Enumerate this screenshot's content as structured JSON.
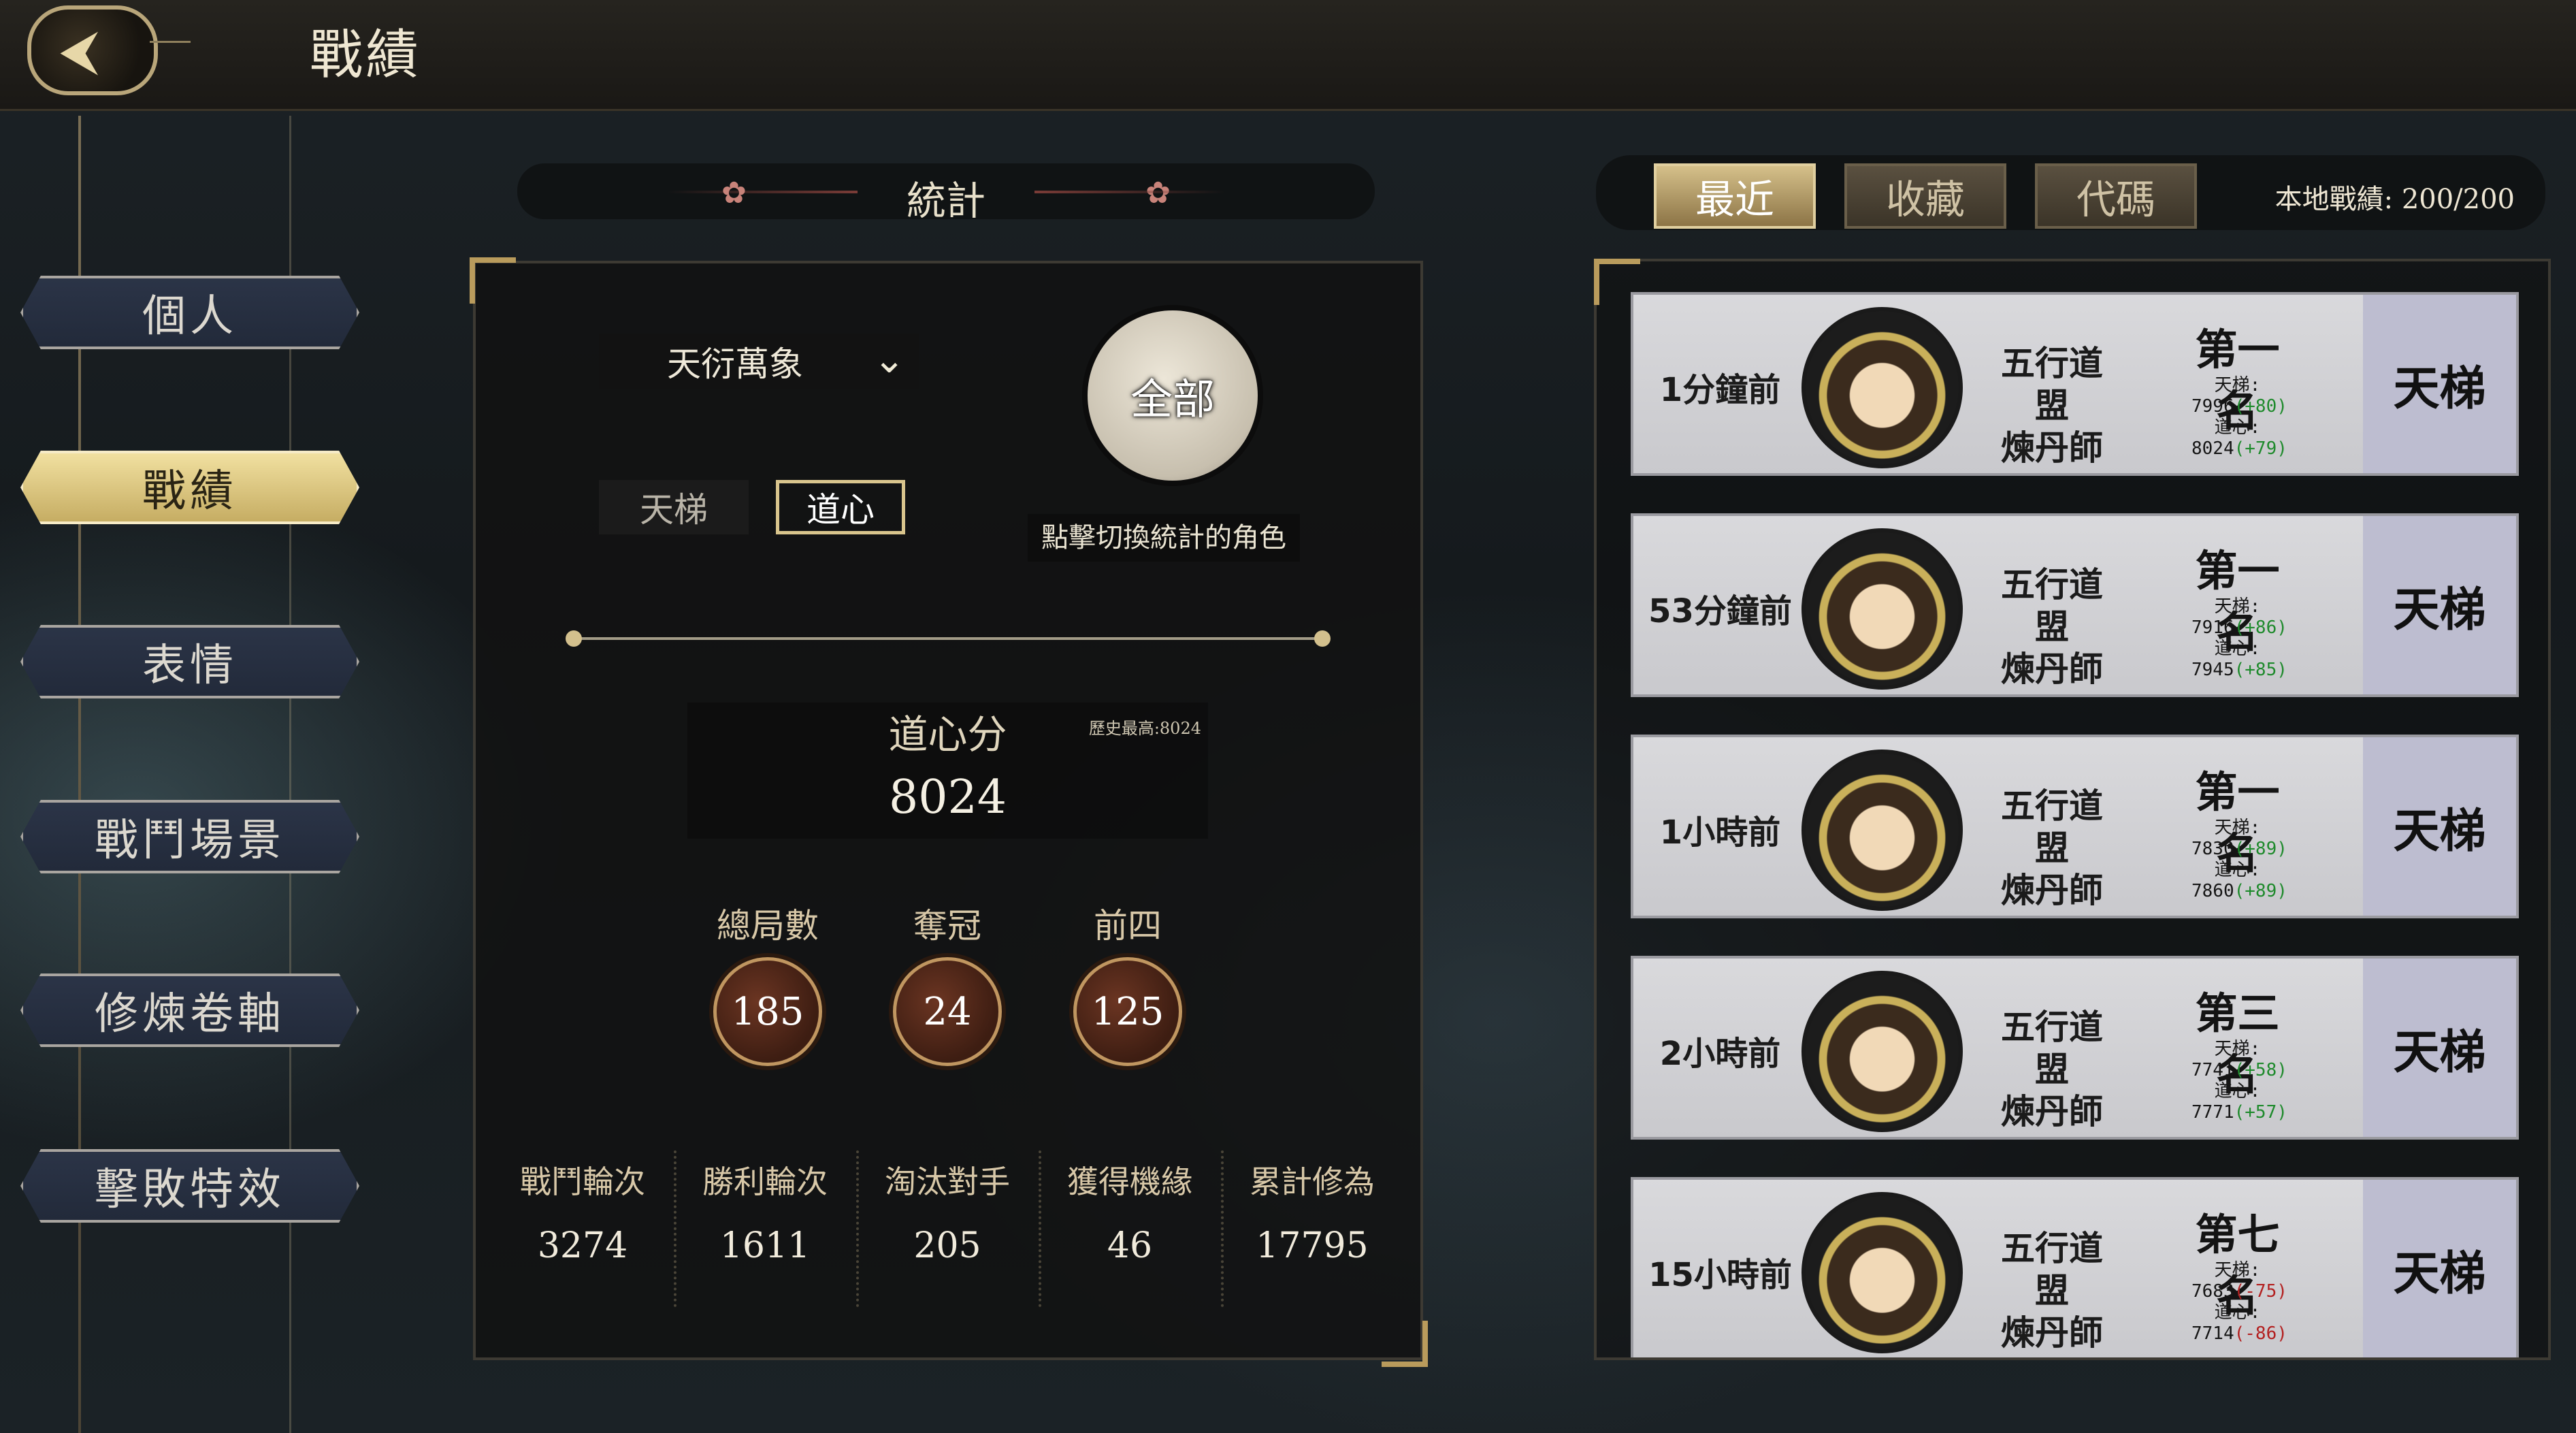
{
  "header": {
    "title": "戰績"
  },
  "sidebar": {
    "items": [
      {
        "label": "個人"
      },
      {
        "label": "戰績"
      },
      {
        "label": "表情"
      },
      {
        "label": "戰鬥場景"
      },
      {
        "label": "修煉卷軸"
      },
      {
        "label": "擊敗特效"
      }
    ],
    "active_index": 1
  },
  "stats": {
    "section_title": "統計",
    "character_dropdown": "天衍萬象",
    "mode_tabs": [
      "天梯",
      "道心"
    ],
    "active_mode": "道心",
    "character_button": "全部",
    "character_hint": "點擊切換統計的角色",
    "score": {
      "label": "道心分",
      "history_high": "歷史最高:8024",
      "value": "8024"
    },
    "summary": [
      {
        "label": "總局數",
        "value": "185"
      },
      {
        "label": "奪冠",
        "value": "24"
      },
      {
        "label": "前四",
        "value": "125"
      }
    ],
    "details": [
      {
        "label": "戰鬥輪次",
        "value": "3274"
      },
      {
        "label": "勝利輪次",
        "value": "1611"
      },
      {
        "label": "淘汰對手",
        "value": "205"
      },
      {
        "label": "獲得機緣",
        "value": "46"
      },
      {
        "label": "累計修為",
        "value": "17795"
      }
    ]
  },
  "records": {
    "tabs": [
      "最近",
      "收藏",
      "代碼"
    ],
    "active_tab": "最近",
    "count_label": "本地戰績: 200/200",
    "items": [
      {
        "time": "1分鐘前",
        "faction_line1": "五行道盟",
        "faction_line2": "煉丹師",
        "rank": "第一名",
        "ladder_label": "天梯:",
        "ladder_value": "7996",
        "ladder_delta": "(+80)",
        "daoxin_label": "道心:",
        "daoxin_value": "8024",
        "daoxin_delta": "(+79)",
        "mode": "天梯"
      },
      {
        "time": "53分鐘前",
        "faction_line1": "五行道盟",
        "faction_line2": "煉丹師",
        "rank": "第一名",
        "ladder_label": "天梯:",
        "ladder_value": "7916",
        "ladder_delta": "(+86)",
        "daoxin_label": "道心:",
        "daoxin_value": "7945",
        "daoxin_delta": "(+85)",
        "mode": "天梯"
      },
      {
        "time": "1小時前",
        "faction_line1": "五行道盟",
        "faction_line2": "煉丹師",
        "rank": "第一名",
        "ladder_label": "天梯:",
        "ladder_value": "7830",
        "ladder_delta": "(+89)",
        "daoxin_label": "道心:",
        "daoxin_value": "7860",
        "daoxin_delta": "(+89)",
        "mode": "天梯"
      },
      {
        "time": "2小時前",
        "faction_line1": "五行道盟",
        "faction_line2": "煉丹師",
        "rank": "第三名",
        "ladder_label": "天梯:",
        "ladder_value": "7741",
        "ladder_delta": "(+58)",
        "daoxin_label": "道心:",
        "daoxin_value": "7771",
        "daoxin_delta": "(+57)",
        "mode": "天梯"
      },
      {
        "time": "15小時前",
        "faction_line1": "五行道盟",
        "faction_line2": "煉丹師",
        "rank": "第七名",
        "ladder_label": "天梯:",
        "ladder_value": "7683",
        "ladder_delta": "(-75)",
        "daoxin_label": "道心:",
        "daoxin_value": "7714",
        "daoxin_delta": "(-86)",
        "mode": "天梯"
      }
    ]
  },
  "icons": {
    "back": "back-arrow-icon",
    "dropdown": "chevron-down-icon",
    "flower": "flower-ornament-icon"
  }
}
